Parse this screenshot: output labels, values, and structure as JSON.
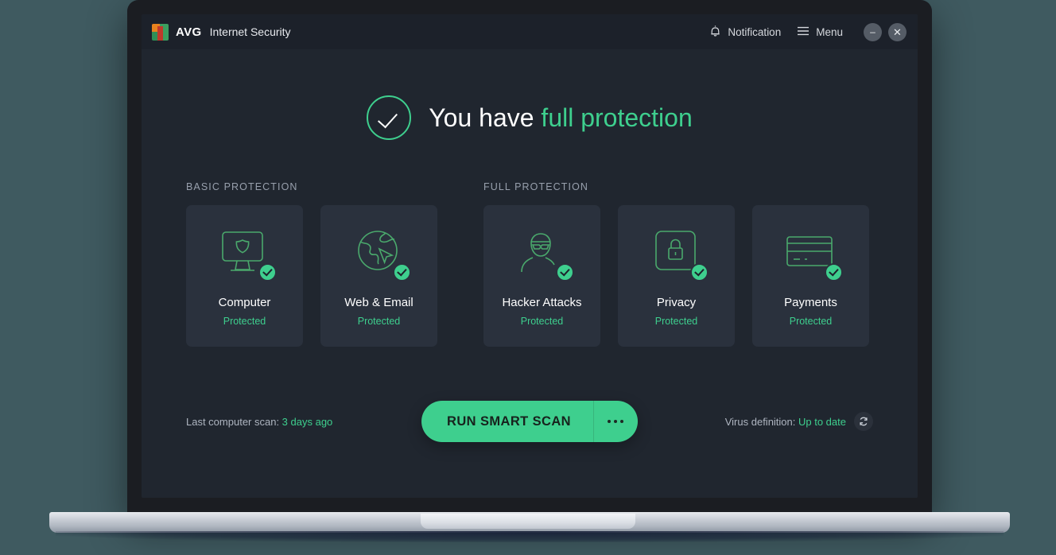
{
  "app": {
    "brand_short": "AVG",
    "title": "Internet Security",
    "logo_icon": "avg-logo-icon"
  },
  "titlebar": {
    "notification_label": "Notification",
    "notification_icon": "bell-icon",
    "menu_label": "Menu",
    "menu_icon": "hamburger-icon",
    "minimize_glyph": "–",
    "close_glyph": "✕"
  },
  "status": {
    "prefix": "You have ",
    "highlight": "full protection",
    "check_icon": "check-circle-icon"
  },
  "sections": [
    {
      "label": "BASIC PROTECTION",
      "cards": [
        {
          "title": "Computer",
          "status": "Protected",
          "icon": "monitor-shield-icon",
          "badge_icon": "check-badge-icon"
        },
        {
          "title": "Web & Email",
          "status": "Protected",
          "icon": "globe-cursor-icon",
          "badge_icon": "check-badge-icon"
        }
      ]
    },
    {
      "label": "FULL PROTECTION",
      "cards": [
        {
          "title": "Hacker Attacks",
          "status": "Protected",
          "icon": "masked-hacker-icon",
          "badge_icon": "check-badge-icon"
        },
        {
          "title": "Privacy",
          "status": "Protected",
          "icon": "lock-icon",
          "badge_icon": "check-badge-icon"
        },
        {
          "title": "Payments",
          "status": "Protected",
          "icon": "credit-card-icon",
          "badge_icon": "check-badge-icon"
        }
      ]
    }
  ],
  "footer": {
    "last_scan_label": "Last computer scan: ",
    "last_scan_value": "3 days ago",
    "scan_button_label": "RUN SMART SCAN",
    "scan_more_icon": "ellipsis-icon",
    "virus_def_label": "Virus definition: ",
    "virus_def_value": "Up to date",
    "refresh_icon": "refresh-icon"
  },
  "colors": {
    "accent_green": "#3ecf8e",
    "app_bg": "#20262f",
    "titlebar_bg": "#1c212a",
    "card_bg": "#2a313d",
    "page_bg": "#3f5a60"
  }
}
